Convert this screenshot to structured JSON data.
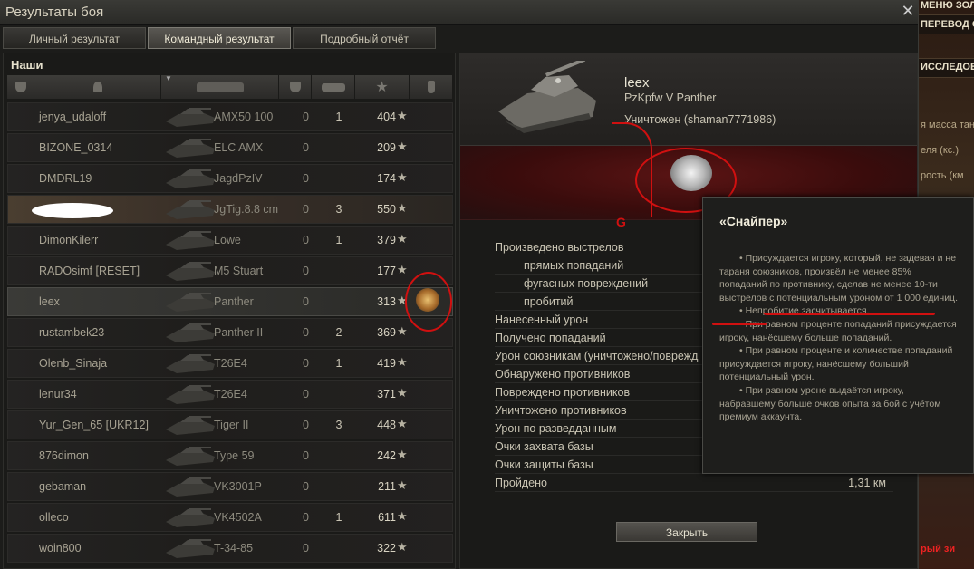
{
  "window": {
    "title": "Результаты боя"
  },
  "tabs": [
    {
      "label": "Личный результат",
      "active": false
    },
    {
      "label": "Командный результат",
      "active": true
    },
    {
      "label": "Подробный отчёт",
      "active": false
    }
  ],
  "team": {
    "label": "Наши",
    "rows": [
      {
        "player": "jenya_udaloff",
        "tank": "AMX50 100",
        "col1": "0",
        "col2": "1",
        "xp": "404"
      },
      {
        "player": "BIZONE_0314",
        "tank": "ELC AMX",
        "col1": "0",
        "col2": "",
        "xp": "209"
      },
      {
        "player": "DMDRL19",
        "tank": "JagdPzIV",
        "col1": "0",
        "col2": "",
        "xp": "174"
      },
      {
        "player": "",
        "tank": "JgTig.8.8 cm",
        "col1": "0",
        "col2": "3",
        "xp": "550"
      },
      {
        "player": "DimonKilerr",
        "tank": "Löwe",
        "col1": "0",
        "col2": "1",
        "xp": "379"
      },
      {
        "player": "RADOsimf [RESET]",
        "tank": "M5 Stuart",
        "col1": "0",
        "col2": "",
        "xp": "177"
      },
      {
        "player": "leex",
        "tank": "Panther",
        "col1": "0",
        "col2": "",
        "xp": "313"
      },
      {
        "player": "rustambek23",
        "tank": "Panther II",
        "col1": "0",
        "col2": "2",
        "xp": "369"
      },
      {
        "player": "Olenb_Sinaja",
        "tank": "T26E4",
        "col1": "0",
        "col2": "1",
        "xp": "419"
      },
      {
        "player": "lenur34",
        "tank": "T26E4",
        "col1": "0",
        "col2": "",
        "xp": "371"
      },
      {
        "player": "Yur_Gen_65 [UKR12]",
        "tank": "Tiger II",
        "col1": "0",
        "col2": "3",
        "xp": "448"
      },
      {
        "player": "876dimon",
        "tank": "Type 59",
        "col1": "0",
        "col2": "",
        "xp": "242"
      },
      {
        "player": "gebaman",
        "tank": "VK3001P",
        "col1": "0",
        "col2": "",
        "xp": "211"
      },
      {
        "player": "olleco",
        "tank": "VK4502A",
        "col1": "0",
        "col2": "1",
        "xp": "611"
      },
      {
        "player": "woin800",
        "tank": "T-34-85",
        "col1": "0",
        "col2": "",
        "xp": "322"
      }
    ],
    "star": "★"
  },
  "detail": {
    "player": "leex",
    "tank": "PzKpfw V Panther",
    "status": "Уничтожен (shaman7771986)",
    "stats": [
      {
        "label": "Произведено выстрелов",
        "value": "",
        "indent": false
      },
      {
        "label": "прямых попаданий",
        "value": "",
        "indent": true
      },
      {
        "label": "фугасных повреждений",
        "value": "",
        "indent": true
      },
      {
        "label": "пробитий",
        "value": "",
        "indent": true
      },
      {
        "label": "Нанесенный урон",
        "value": "",
        "indent": false
      },
      {
        "label": "Получено попаданий",
        "value": "",
        "indent": false
      },
      {
        "label": "Урон союзникам (уничтожено/поврежд",
        "value": "",
        "indent": false
      },
      {
        "label": "Обнаружено противников",
        "value": "",
        "indent": false
      },
      {
        "label": "Повреждено противников",
        "value": "",
        "indent": false
      },
      {
        "label": "Уничтожено противников",
        "value": "",
        "indent": false
      },
      {
        "label": "Урон по разведданным",
        "value": "",
        "indent": false
      },
      {
        "label": "Очки захвата базы",
        "value": "",
        "indent": false
      },
      {
        "label": "Очки защиты базы",
        "value": "",
        "indent": false
      },
      {
        "label": "Пройдено",
        "value": "1,31 км",
        "indent": false
      }
    ],
    "close_label": "Закрыть"
  },
  "tooltip": {
    "title": "«Снайпер»",
    "paragraphs": [
      "• Присуждается игроку, который, не задевая и не тараня союзников, произвёл не менее 85% попаданий по противнику, сделав не менее 10-ти выстрелов с потенциальным уроном от 1 000 единиц.",
      "• Непробитие засчитывается.",
      "• При равном проценте попаданий присуждается игроку, нанёсшему больше попаданий.",
      "• При равном проценте и количестве попаданий присуждается игроку, нанёсшему больший потенциальный урон.",
      "• При равном уроне выдаётся игроку, набравшему больше очков опыта за бой с учётом премиум аккаунта."
    ]
  },
  "annotation": {
    "mark": "G"
  },
  "background": {
    "labels": [
      "МЕНЮ ЗОЛО",
      "ПЕРЕВОД ОП",
      "ИССЛЕДОВА",
      "я масса тан",
      "еля (кс.)",
      "рость (км",
      "рый зи"
    ]
  },
  "colors": {
    "accent_red": "#d01010",
    "panel": "#1a1a18"
  }
}
